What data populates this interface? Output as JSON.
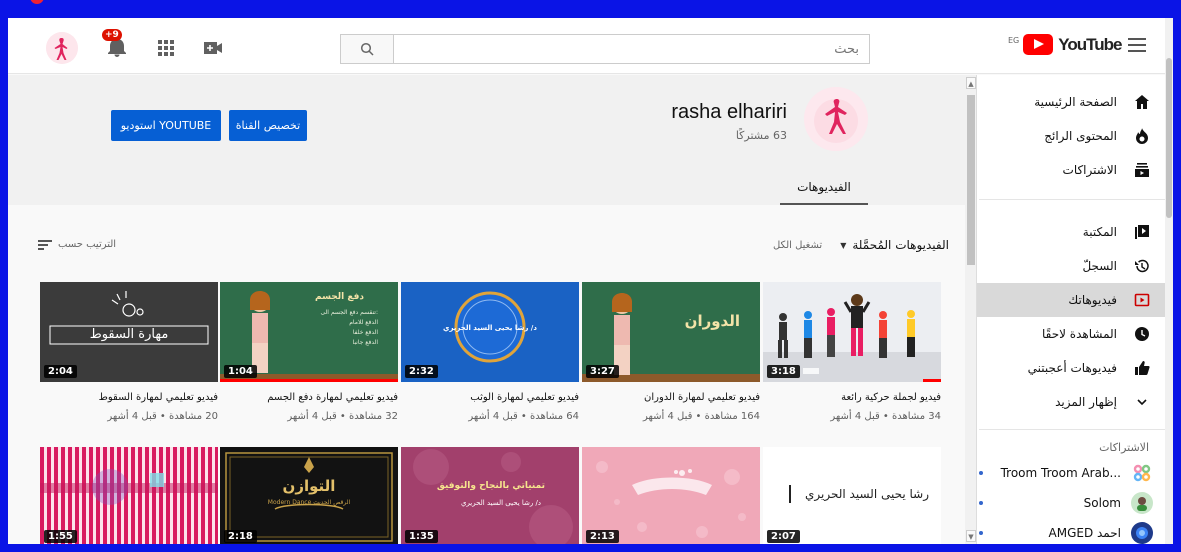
{
  "masthead": {
    "search_placeholder": "بحث",
    "notifications_badge": "+9",
    "logo_text": "YouTube",
    "logo_region": "EG"
  },
  "sidebar": {
    "items": [
      {
        "label": "الصفحة الرئيسية",
        "icon": "home-icon"
      },
      {
        "label": "المحتوى الرائج",
        "icon": "fire-icon"
      },
      {
        "label": "الاشتراكات",
        "icon": "subscriptions-icon"
      },
      {
        "label": "المكتبة",
        "icon": "library-icon"
      },
      {
        "label": "السجلّ",
        "icon": "history-icon"
      },
      {
        "label": "فيديوهاتك",
        "icon": "your-videos-icon"
      },
      {
        "label": "المشاهدة لاحقًا",
        "icon": "watch-later-icon"
      },
      {
        "label": "فيديوهات أعجبتني",
        "icon": "thumbs-up-icon"
      },
      {
        "label": "إظهار المزيد",
        "icon": "chevron-down-icon"
      }
    ],
    "subscriptions_heading": "الاشتراكات",
    "subscriptions": [
      {
        "name": "Troom Troom Arab...",
        "icon": "channel-troom-icon"
      },
      {
        "name": "Solom",
        "icon": "channel-solom-icon"
      },
      {
        "name": "AMGED احمد",
        "icon": "channel-amged-icon"
      }
    ]
  },
  "channel": {
    "name": "rasha elhariri",
    "subscribers": "63 مشتركًا",
    "customize_label": "تخصيص القناة",
    "studio_label": "استوديو YOUTUBE",
    "tab_videos": "الفيديوهات"
  },
  "shelf": {
    "title": "الفيديوهات المُحمَّلة",
    "play_all": "تشغيل الكل",
    "sort_label": "الترتيب حسب"
  },
  "videos_row1": [
    {
      "title": "فيديو لجملة حركية رائعة",
      "meta": "34 مشاهدة • قبل 4 أشهر",
      "duration": "3:18",
      "progress": 0.1
    },
    {
      "title": "فيديو تعليمي لمهارة الدوران",
      "meta": "164 مشاهدة • قبل 4 أشهر",
      "duration": "3:27",
      "progress": 0
    },
    {
      "title": "فيديو تعليمي لمهارة الوثب",
      "meta": "64 مشاهدة • قبل 4 أشهر",
      "duration": "2:32",
      "progress": 0
    },
    {
      "title": "فيديو تعليمي لمهارة دفع الجسم",
      "meta": "32 مشاهدة • قبل 4 أشهر",
      "duration": "1:04",
      "progress": 1.0
    },
    {
      "title": "فيديو تعليمي لمهارة السقوط",
      "meta": "20 مشاهدة • قبل 4 أشهر",
      "duration": "2:04",
      "progress": 0
    }
  ],
  "videos_row2": [
    {
      "duration": "2:07",
      "progress": 1.0,
      "thumb_text": "رشا يحيى السيد الحريري"
    },
    {
      "duration": "2:13",
      "progress": 0
    },
    {
      "duration": "1:35",
      "progress": 0,
      "thumb_text": "تمنياتي بالنجاح والتوفيق",
      "thumb_sub": "د/ رشا يحيى السيد الحريري"
    },
    {
      "duration": "2:18",
      "progress": 0,
      "thumb_text": "التوازن",
      "thumb_sub": "Modern Dance الرقص الحديث"
    },
    {
      "duration": "1:55",
      "progress": 0.1
    }
  ],
  "thumb_texts": {
    "fall": "مهارة السقوط",
    "turn": "الدوران",
    "push_title": "دفع الجسم",
    "push_lines": [
      "تنقسم دفع الجسم الى:",
      "الدفع للامام",
      "الدفع خلفا",
      "الدفع جانبا"
    ],
    "jump": "د/ رشا يحيى السيد الحريري"
  },
  "colors": {
    "accent": "#065fd4",
    "brand_red": "#ff0000",
    "active_bg": "#d9d9d9"
  }
}
